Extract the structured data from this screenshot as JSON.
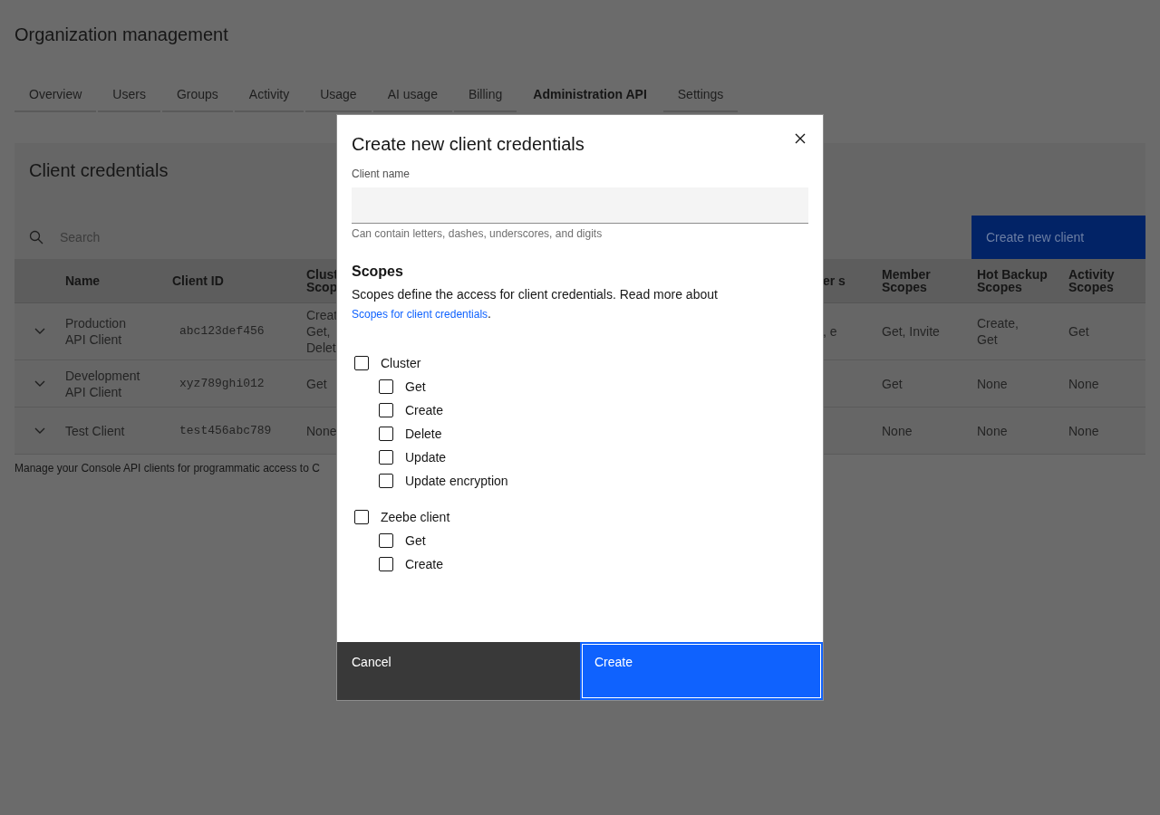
{
  "page": {
    "title": "Organization management"
  },
  "tabs": [
    {
      "label": "Overview",
      "selected": false
    },
    {
      "label": "Users",
      "selected": false
    },
    {
      "label": "Groups",
      "selected": false
    },
    {
      "label": "Activity",
      "selected": false
    },
    {
      "label": "Usage",
      "selected": false
    },
    {
      "label": "AI usage",
      "selected": false
    },
    {
      "label": "Billing",
      "selected": false
    },
    {
      "label": "Administration API",
      "selected": true
    },
    {
      "label": "Settings",
      "selected": false
    }
  ],
  "card": {
    "title": "Client credentials",
    "search": {
      "placeholder": "Search"
    },
    "create_button": "Create new client"
  },
  "table": {
    "columns": [
      "Name",
      "Client ID",
      "Clust Scop",
      "",
      "er s",
      "Member Scopes",
      "Hot Backup Scopes",
      "Activity Scopes"
    ],
    "rows": [
      {
        "cells": [
          "Production API Client",
          "abc123def456",
          "Creat Get, Delet",
          "",
          ", e",
          "Get, Invite",
          "Create, Get",
          "Get"
        ]
      },
      {
        "cells": [
          "Development API Client",
          "xyz789ghi012",
          "Get",
          "",
          "",
          "Get",
          "None",
          "None"
        ]
      },
      {
        "cells": [
          "Test Client",
          "test456abc789",
          "None",
          "",
          "",
          "None",
          "None",
          "None"
        ]
      }
    ]
  },
  "footer_note": "Manage your Console API clients for programmatic access to C",
  "modal": {
    "title": "Create new client credentials",
    "field": {
      "label": "Client name",
      "helper": "Can contain letters, dashes, underscores, and digits"
    },
    "scopes_heading": "Scopes",
    "scopes_text": "Scopes define the access for client credentials. Read more about",
    "scopes_link": "Scopes for client credentials",
    "scopes_period": ".",
    "groups": [
      {
        "label": "Cluster",
        "checked": false,
        "children": [
          {
            "label": "Get",
            "checked": false
          },
          {
            "label": "Create",
            "checked": false
          },
          {
            "label": "Delete",
            "checked": false
          },
          {
            "label": "Update",
            "checked": false
          },
          {
            "label": "Update encryption",
            "checked": false
          }
        ]
      },
      {
        "label": "Zeebe client",
        "checked": false,
        "children": [
          {
            "label": "Get",
            "checked": false
          },
          {
            "label": "Create",
            "checked": false
          }
        ]
      }
    ],
    "buttons": [
      {
        "label": "Cancel",
        "kind": "secondary"
      },
      {
        "label": "Create",
        "kind": "primary"
      }
    ]
  }
}
